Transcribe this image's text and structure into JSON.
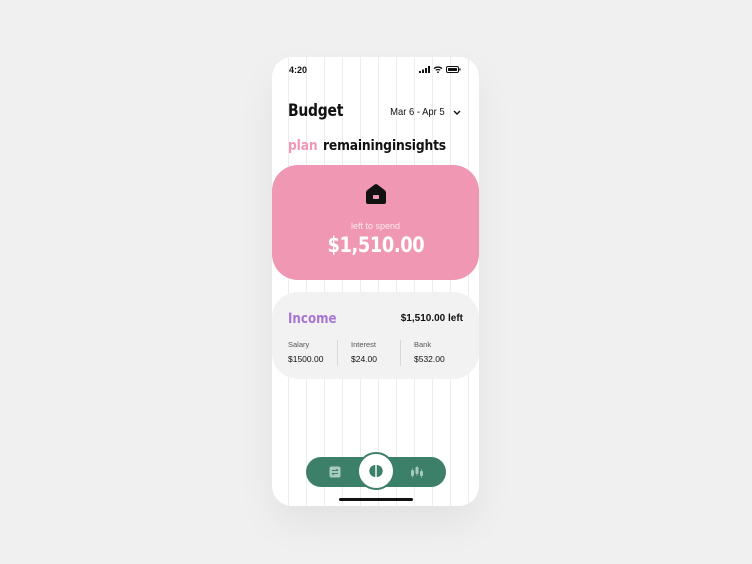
{
  "status_bar": {
    "time": "4:20"
  },
  "header": {
    "title": "Budget",
    "date_range": "Mar 6 - Apr 5"
  },
  "tabs": [
    {
      "label": "plan",
      "active": true
    },
    {
      "label": "remaining",
      "active": false
    },
    {
      "label": "insights",
      "active": false
    }
  ],
  "hero": {
    "label": "left to spend",
    "amount": "$1,510.00",
    "icon": "home-icon"
  },
  "income": {
    "title": "Income",
    "left": "$1,510.00 left",
    "sources": [
      {
        "label": "Salary",
        "value": "$1500.00"
      },
      {
        "label": "Interest",
        "value": "$24.00"
      },
      {
        "label": "Bank",
        "value": "$532.00"
      }
    ]
  },
  "nav": {
    "items": [
      "transactions-icon",
      "budget-icon",
      "stocks-icon"
    ]
  },
  "colors": {
    "pink": "#f097b3",
    "purple": "#a875d3",
    "green": "#3d8069",
    "card": "#f2f2f2"
  }
}
